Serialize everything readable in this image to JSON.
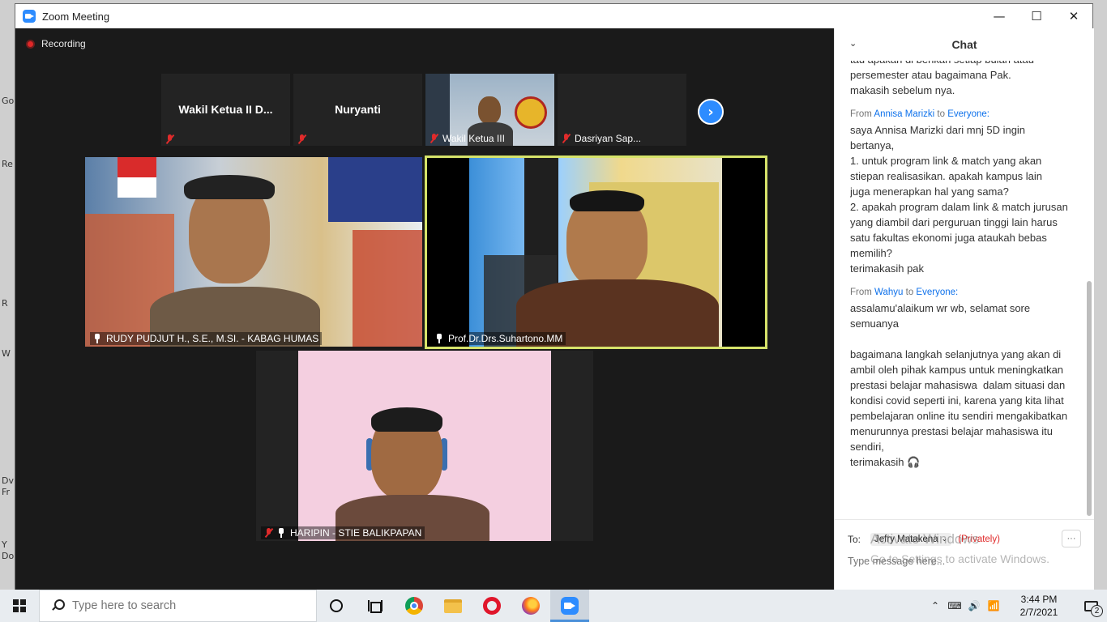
{
  "window": {
    "title": "Zoom Meeting",
    "minimize": "—",
    "maximize": "☐",
    "close": "✕"
  },
  "meeting": {
    "recording_label": "Recording",
    "thumbnails": [
      {
        "name": "Wakil Ketua II D...",
        "caption": ""
      },
      {
        "name": "Nuryanti",
        "caption": ""
      },
      {
        "name": "",
        "caption": "Wakil Ketua III"
      },
      {
        "name": "",
        "caption": "Dasriyan Sap..."
      }
    ],
    "next_label": "›",
    "tiles": [
      {
        "caption": "RUDY PUDJUT H., S.E., M.SI. - KABAG HUMAS"
      },
      {
        "caption": "Prof.Dr.Drs.Suhartono.MM"
      },
      {
        "caption": "HARIPIN - STIE BALIKPAPAN"
      }
    ],
    "active_speaker_color": "#d6e36a"
  },
  "chat": {
    "title": "Chat",
    "collapse_icon": "⌄",
    "partial_message": "tau apakah di berikan setiap bulan atau persemester atau bagaimana Pak.\nmakasih sebelum nya.",
    "messages": [
      {
        "from_label": "From",
        "sender": "Annisa Marizki",
        "to_label": "to",
        "recipient": "Everyone:",
        "text": "saya Annisa Marizki dari mnj 5D ingin bertanya,\n1. untuk program link & match yang akan stiepan realisasikan. apakah kampus lain   juga menerapkan hal yang sama?\n2. apakah program dalam link & match jurusan yang diambil dari perguruan tinggi lain harus satu fakultas ekonomi juga ataukah bebas memilih?\nterimakasih pak"
      },
      {
        "from_label": "From",
        "sender": "Wahyu",
        "to_label": "to",
        "recipient": "Everyone:",
        "text": "assalamu'alaikum wr wb, selamat sore semuanya\n\nbagaimana langkah selanjutnya yang akan di ambil oleh pihak kampus untuk meningkatkan prestasi belajar mahasiswa  dalam situasi dan kondisi covid seperti ini, karena yang kita lihat pembelajaran online itu sendiri mengakibatkan menurunnya prestasi belajar mahasiswa itu sendiri,\nterimakasih 🎧"
      }
    ],
    "to_label": "To:",
    "recipient_selected": "Jefry Matakena",
    "privately_label": "(Privately)",
    "more_label": "···",
    "input_placeholder": "Type message here...",
    "activate_title": "Activate Windows",
    "activate_subtitle": "Go to Settings to activate Windows."
  },
  "desktop": {
    "labels": [
      "Go",
      "Re",
      "R",
      "W",
      "Dv",
      "Fr",
      "Y",
      "Do"
    ]
  },
  "taskbar": {
    "search_placeholder": "Type here to search",
    "tray_chevron": "⌃",
    "tray_lang": "⌨",
    "tray_volume": "🔊",
    "tray_network": "📶",
    "time": "3:44 PM",
    "date": "2/7/2021",
    "notification_count": "2"
  }
}
